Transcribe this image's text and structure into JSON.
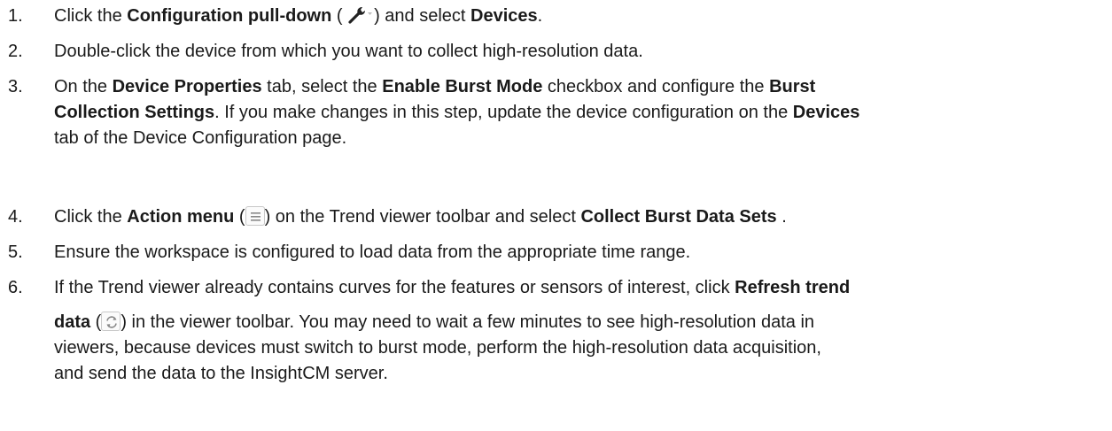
{
  "steps": [
    {
      "number": "1.",
      "t1": "Click the ",
      "b1": "Configuration pull-down",
      "t2": " (",
      "t3": ") and select ",
      "b2": "Devices",
      "t4": "."
    },
    {
      "number": "2.",
      "t1": "Double-click the device from which you want to collect high-resolution data."
    },
    {
      "number": "3.",
      "l1_t1": "On the ",
      "l1_b1": "Device Properties",
      "l1_t2": " tab, select the ",
      "l1_b2": "Enable Burst Mode",
      "l1_t3": " checkbox and configure the ",
      "l1_b3": "Burst",
      "l2_b1": "Collection Settings",
      "l2_t1": ". If you make changes in this step, update the device configuration on the ",
      "l2_b2": "Devices",
      "l3_t1": "tab of the Device Configuration page."
    },
    {
      "number": "4.",
      "t1": "Click the ",
      "b1": "Action menu",
      "t2": " (",
      "t3": ") on the Trend viewer toolbar and select ",
      "b2": "Collect Burst Data Sets",
      "t4": " ."
    },
    {
      "number": "5.",
      "t1": "Ensure the workspace is configured to load data from the appropriate time range."
    },
    {
      "number": "6.",
      "l1_t1": "If the Trend viewer already contains curves for the features or sensors of interest, click ",
      "l1_b1": "Refresh trend",
      "l2_b1": "data",
      "l2_t1": " (",
      "l2_t2": ") in the viewer toolbar. You may need to wait a few minutes to see high-resolution data in",
      "l3_t1": "viewers, because devices must switch to burst mode, perform the high-resolution data acquisition,",
      "l4_t1": "and send the data to the InsightCM server."
    }
  ],
  "icons": {
    "configuration": "wrench-icon",
    "action_menu": "hamburger-menu-icon",
    "refresh": "refresh-icon"
  }
}
